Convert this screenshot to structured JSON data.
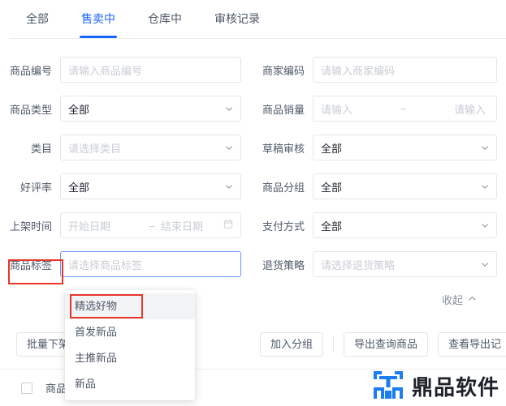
{
  "tabs": [
    {
      "label": "全部",
      "active": false
    },
    {
      "label": "售卖中",
      "active": true
    },
    {
      "label": "仓库中",
      "active": false
    },
    {
      "label": "审核记录",
      "active": false
    }
  ],
  "form": {
    "rows": [
      {
        "left": {
          "label": "商品编号",
          "type": "input",
          "placeholder": "请输入商品编号",
          "value": ""
        },
        "right": {
          "label": "商家编码",
          "type": "input",
          "placeholder": "请输入商家编码",
          "value": ""
        }
      },
      {
        "left": {
          "label": "商品类型",
          "type": "select",
          "placeholder": "",
          "value": "全部"
        },
        "right": {
          "label": "商品销量",
          "type": "range",
          "placeholder_from": "请输入",
          "separator": "~",
          "placeholder_to": "请输入"
        }
      },
      {
        "left": {
          "label": "类目",
          "type": "select",
          "placeholder": "请选择类目",
          "value": ""
        },
        "right": {
          "label": "草稿审核",
          "type": "select",
          "placeholder": "",
          "value": "全部"
        }
      },
      {
        "left": {
          "label": "好评率",
          "type": "select",
          "placeholder": "",
          "value": "全部"
        },
        "right": {
          "label": "商品分组",
          "type": "select",
          "placeholder": "",
          "value": "全部"
        }
      },
      {
        "left": {
          "label": "上架时间",
          "type": "daterange",
          "placeholder_from": "开始日期",
          "separator": "–",
          "placeholder_to": "结束日期"
        },
        "right": {
          "label": "支付方式",
          "type": "select",
          "placeholder": "",
          "value": "全部"
        }
      },
      {
        "left": {
          "label": "商品标签",
          "type": "select",
          "placeholder": "请选择商品标签",
          "value": "",
          "focused": true,
          "highlighted": true
        },
        "right": {
          "label": "退货策略",
          "type": "select",
          "placeholder": "请选择退货策略",
          "value": ""
        }
      }
    ],
    "collapse_label": "收起"
  },
  "tag_dropdown": {
    "items": [
      {
        "label": "精选好物",
        "hover": true,
        "highlighted": true
      },
      {
        "label": "首发新品",
        "hover": false,
        "highlighted": false
      },
      {
        "label": "主推新品",
        "hover": false,
        "highlighted": false
      },
      {
        "label": "新品",
        "hover": false,
        "highlighted": false
      }
    ]
  },
  "actions": {
    "batch_offshelf": "批量下架",
    "add_group": "加入分组",
    "export_query": "导出查询商品",
    "view_export": "查看导出记"
  },
  "table": {
    "select_all_checked": false,
    "first_column": "商品"
  },
  "watermark": {
    "text": "鼎品软件",
    "logo_color": "#1a7ef2"
  },
  "colors": {
    "accent": "#1966ff",
    "annotation": "#e8352c",
    "placeholder": "#c9cdd4",
    "border": "#e5e6eb",
    "focus_border": "#6c93f5"
  }
}
